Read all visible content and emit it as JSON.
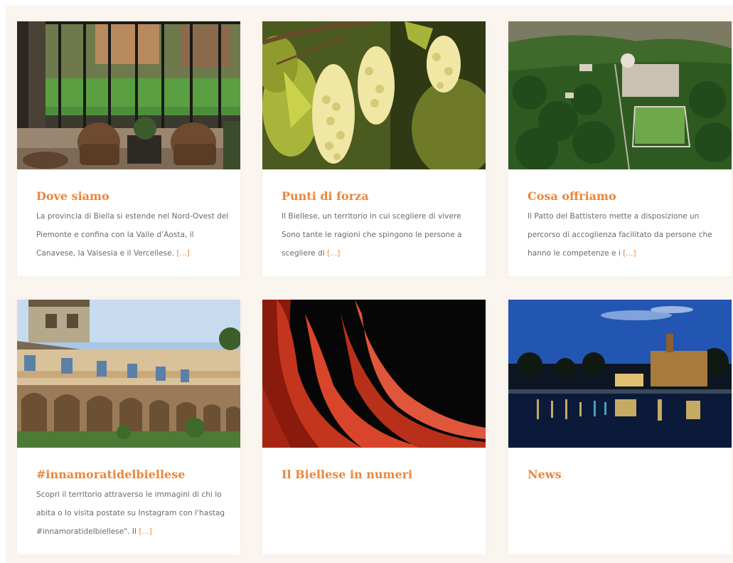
{
  "colors": {
    "accent": "#e9863c",
    "text": "#6a6a6a",
    "background": "#fbf5f0"
  },
  "cards": [
    {
      "title": "Dove siamo",
      "excerpt": "La provincia di Biella si estende nel Nord-Ovest del Piemonte e confina con la Valle d’Aosta, il Canavese, la Valsesia e il Vercellese.",
      "more": "[...]"
    },
    {
      "title": "Punti di forza",
      "excerpt": "Il Biellese, un territorio in cui scegliere di vivere Sono tante le ragioni che spingono le persone a scegliere di",
      "more": "[...]"
    },
    {
      "title": "Cosa offriamo",
      "excerpt": "Il Patto del Battistero mette a disposizione un percorso di accoglienza facilitato da persone che hanno le competenze e i",
      "more": "[...]"
    },
    {
      "title": "#innamoratidelbiellese",
      "excerpt": "Scopri il territorio attraverso le immagini di chi lo abita o lo visita postate su Instagram con l'hastag #innamoratidelbiellese\". Il",
      "more": "[...]"
    },
    {
      "title": "Il Biellese in numeri",
      "excerpt": "",
      "more": ""
    },
    {
      "title": "News",
      "excerpt": "",
      "more": ""
    }
  ]
}
